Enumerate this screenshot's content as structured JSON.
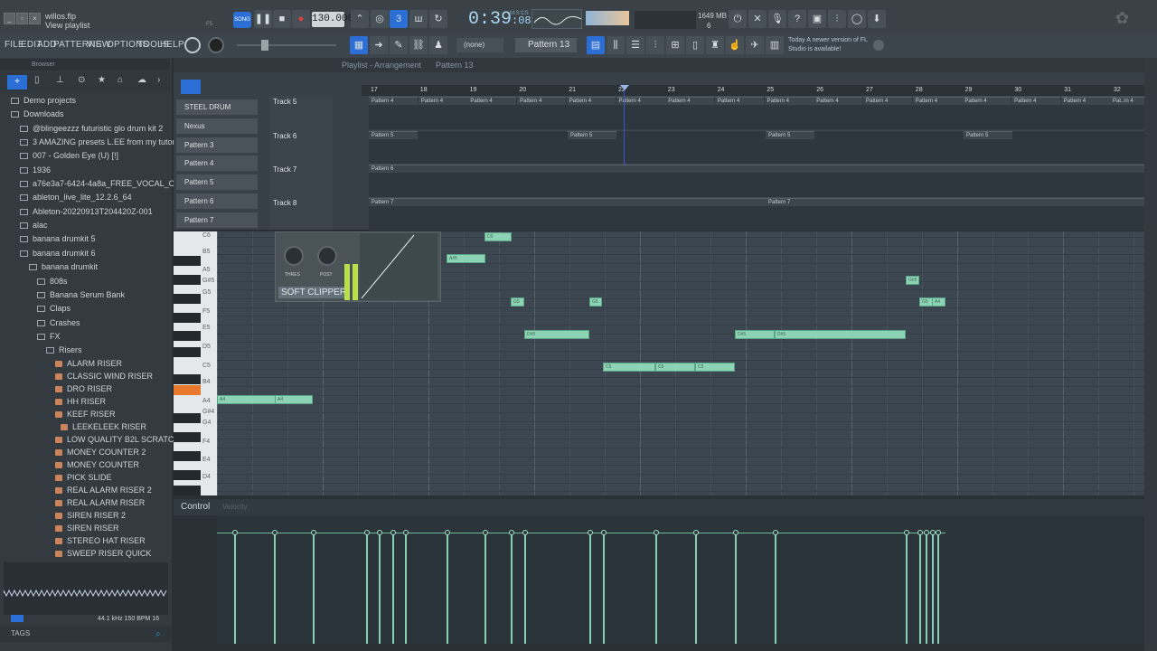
{
  "titlebar": {
    "file_name": "willos.flp",
    "subtitle": "View playlist",
    "tempo": "130.000",
    "time": "0:39",
    "time_sub": ":08",
    "msc": "M:S:CS",
    "memory": "1649 MB",
    "mem_sub": "6",
    "pat_song": "SONG",
    "f5": "F5"
  },
  "menu": {
    "items": [
      "FILE",
      "EDIT",
      "ADD",
      "PATTERNS",
      "VIEW",
      "OPTIONS",
      "TOOLS",
      "HELP"
    ],
    "none_selector": "(none)",
    "pattern_selector": "Pattern 13",
    "news": "Today  A newer version of FL Studio is available!"
  },
  "browser": {
    "header": "Browser",
    "items": [
      {
        "label": "Demo projects",
        "indent": 0,
        "type": "folder"
      },
      {
        "label": "Downloads",
        "indent": 0,
        "type": "folder"
      },
      {
        "label": "@blingeezzz futuristic glo drum kit 2",
        "indent": 1,
        "type": "folder"
      },
      {
        "label": "3 AMAZING presets L.EE from my tutorial",
        "indent": 1,
        "type": "folder"
      },
      {
        "label": "007 - Golden Eye (U) [!]",
        "indent": 1,
        "type": "folder"
      },
      {
        "label": "1936",
        "indent": 1,
        "type": "folder"
      },
      {
        "label": "a76e3a7-6424-4a8a_FREE_VOCAL_CHAIN",
        "indent": 1,
        "type": "folder"
      },
      {
        "label": "ableton_live_lite_12.2.6_64",
        "indent": 1,
        "type": "folder"
      },
      {
        "label": "Ableton-20220913T204420Z-001",
        "indent": 1,
        "type": "folder"
      },
      {
        "label": "alac",
        "indent": 1,
        "type": "folder"
      },
      {
        "label": "banana drumkit 5",
        "indent": 1,
        "type": "folder"
      },
      {
        "label": "banana drumkit 6",
        "indent": 1,
        "type": "folder"
      },
      {
        "label": "banana drumkit",
        "indent": 2,
        "type": "folder"
      },
      {
        "label": "808s",
        "indent": 3,
        "type": "folder"
      },
      {
        "label": "Banana Serum Bank",
        "indent": 3,
        "type": "folder"
      },
      {
        "label": "Claps",
        "indent": 3,
        "type": "folder"
      },
      {
        "label": "Crashes",
        "indent": 3,
        "type": "folder"
      },
      {
        "label": "FX",
        "indent": 3,
        "type": "folder"
      },
      {
        "label": "Risers",
        "indent": 4,
        "type": "folder"
      },
      {
        "label": "ALARM RISER",
        "indent": 5,
        "type": "fx"
      },
      {
        "label": "CLASSIC WIND RISER",
        "indent": 5,
        "type": "fx"
      },
      {
        "label": "DRO RISER",
        "indent": 5,
        "type": "fx"
      },
      {
        "label": "HH RISER",
        "indent": 5,
        "type": "fx"
      },
      {
        "label": "KEEF RISER",
        "indent": 5,
        "type": "fx"
      },
      {
        "label": "LEEKELEEK RISER",
        "indent": 6,
        "type": "fx"
      },
      {
        "label": "LOW QUALITY B2L SCRATCH",
        "indent": 5,
        "type": "fx"
      },
      {
        "label": "MONEY COUNTER 2",
        "indent": 5,
        "type": "fx"
      },
      {
        "label": "MONEY COUNTER",
        "indent": 5,
        "type": "fx"
      },
      {
        "label": "PICK SLIDE",
        "indent": 5,
        "type": "fx"
      },
      {
        "label": "REAL ALARM RISER 2",
        "indent": 5,
        "type": "fx"
      },
      {
        "label": "REAL ALARM RISER",
        "indent": 5,
        "type": "fx"
      },
      {
        "label": "SIREN RISER 2",
        "indent": 5,
        "type": "fx"
      },
      {
        "label": "SIREN RISER",
        "indent": 5,
        "type": "fx"
      },
      {
        "label": "STEREO HAT RISER",
        "indent": 5,
        "type": "fx"
      },
      {
        "label": "SWEEP RISER QUICK",
        "indent": 5,
        "type": "fx"
      }
    ],
    "wave_info": "44.1 kHz 150 BPM 16",
    "tags": "TAGS"
  },
  "playlist": {
    "title": "Playlist - Arrangement",
    "pattern": "Pattern 13",
    "ruler": [
      "17",
      "18",
      "19",
      "20",
      "21",
      "22",
      "23",
      "24",
      "25",
      "26",
      "27",
      "28",
      "29",
      "30",
      "31",
      "32"
    ],
    "tracks": [
      {
        "name": "Track 5",
        "clip": "Pattern 4"
      },
      {
        "name": "Track 6",
        "clip": "Pattern 5"
      },
      {
        "name": "Track 7",
        "clip": "Pattern 6"
      },
      {
        "name": "Track 8",
        "clip": "Pattern 7"
      }
    ],
    "last_clip": "Pat..rn 4"
  },
  "channels": [
    "STEEL DRUM",
    "Nexus",
    "Pattern 3",
    "Pattern 4",
    "Pattern 5",
    "Pattern 6",
    "Pattern 7"
  ],
  "piano": {
    "keys": [
      "C6",
      "B5",
      "A5",
      "G#5",
      "G5",
      "F5",
      "E5",
      "D5",
      "C5",
      "B4",
      "A4",
      "G#4",
      "G4",
      "F4",
      "E4",
      "D4"
    ]
  },
  "notes": [
    {
      "label": "C6",
      "pitch": "C6"
    },
    {
      "label": "A#5",
      "pitch": "A#5"
    },
    {
      "label": "G5",
      "pitch": "G5"
    },
    {
      "label": "G5",
      "pitch": "G5"
    },
    {
      "label": "D#5",
      "pitch": "D#5"
    },
    {
      "label": "C5",
      "pitch": "C5"
    },
    {
      "label": "C5",
      "pitch": "C5"
    },
    {
      "label": "C5",
      "pitch": "C5"
    },
    {
      "label": "D#5",
      "pitch": "D#5"
    },
    {
      "label": "D#5",
      "pitch": "D#5"
    },
    {
      "label": "G#5",
      "pitch": "G#5"
    },
    {
      "label": "G5",
      "pitch": "G5"
    },
    {
      "label": "A4",
      "pitch": "A4"
    },
    {
      "label": "A4",
      "pitch": "A4"
    },
    {
      "label": "A4",
      "pitch": "A4"
    }
  ],
  "plugin": {
    "name": "SOFT CLIPPER",
    "knob1": "THRES",
    "knob2": "POST"
  },
  "control": {
    "label": "Control",
    "param": "Velocity"
  },
  "colors": {
    "note": "#8ed3b3",
    "accent": "#6fb89a",
    "key_highlight": "#e8782c"
  }
}
